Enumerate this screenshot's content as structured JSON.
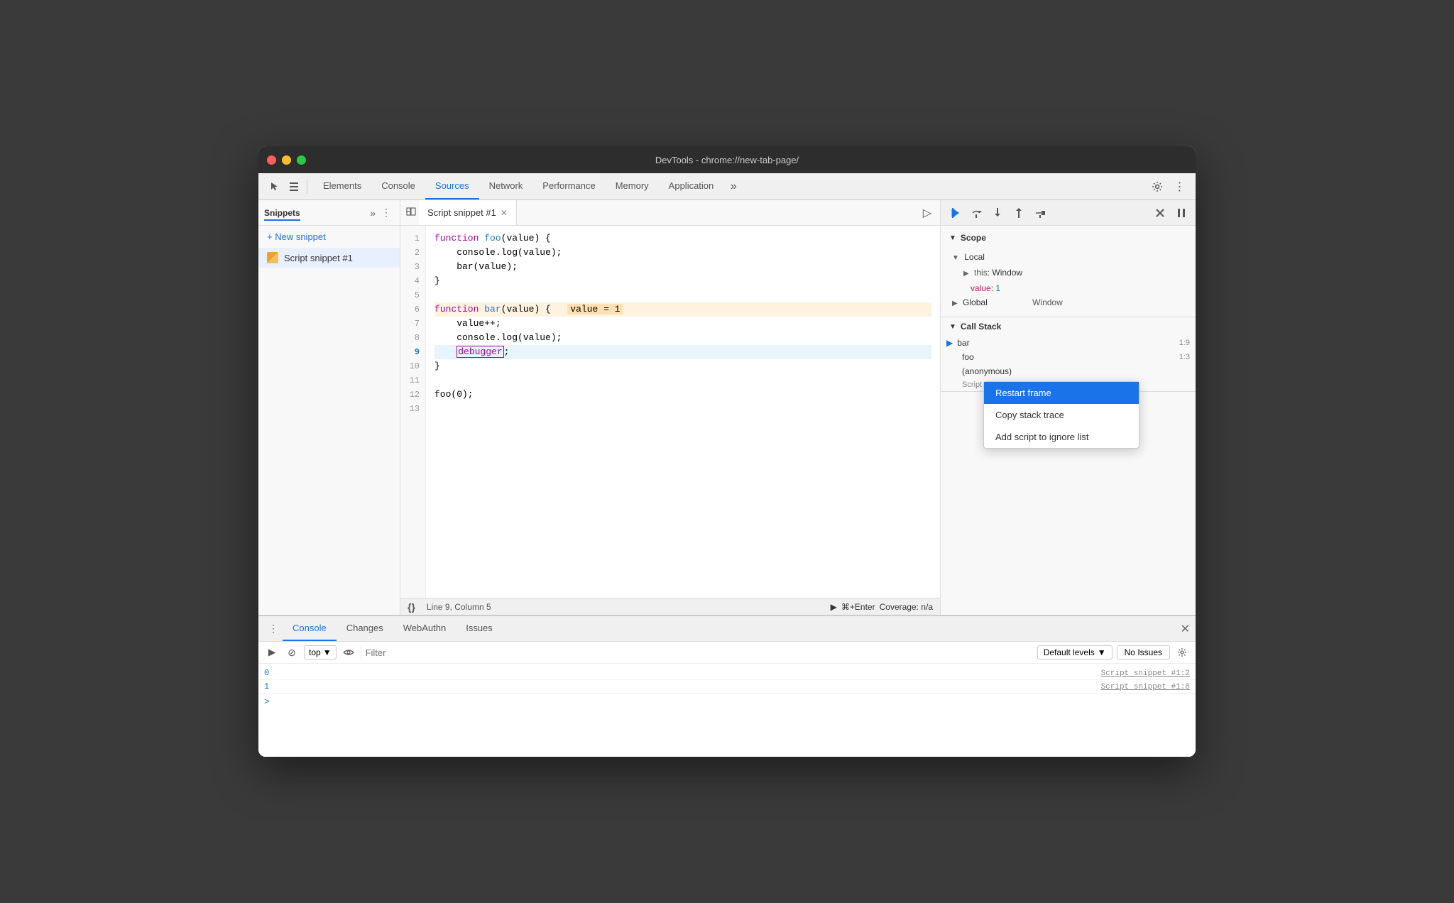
{
  "window": {
    "title": "DevTools - chrome://new-tab-page/",
    "traffic_lights": [
      "close",
      "minimize",
      "maximize"
    ]
  },
  "top_tabs": {
    "items": [
      {
        "label": "Elements",
        "active": false
      },
      {
        "label": "Console",
        "active": false
      },
      {
        "label": "Sources",
        "active": true
      },
      {
        "label": "Network",
        "active": false
      },
      {
        "label": "Performance",
        "active": false
      },
      {
        "label": "Memory",
        "active": false
      },
      {
        "label": "Application",
        "active": false
      }
    ]
  },
  "sidebar": {
    "title": "Snippets",
    "new_snippet_label": "+ New snippet",
    "snippet_name": "Script snippet #1"
  },
  "editor": {
    "tab_label": "Script snippet #1",
    "lines": [
      "function foo(value) {",
      "    console.log(value);",
      "    bar(value);",
      "}",
      "",
      "function bar(value) {   value = 1",
      "    value++;",
      "    console.log(value);",
      "    debugger;",
      "}",
      "",
      "foo(0);",
      ""
    ],
    "active_line": 9,
    "status": {
      "line_col": "Line 9, Column 5",
      "run_shortcut": "⌘+Enter",
      "coverage": "Coverage: n/a"
    }
  },
  "right_panel": {
    "scope": {
      "title": "Scope",
      "local_title": "Local",
      "this_label": "this",
      "this_value": "Window",
      "value_label": "value",
      "value_num": "1",
      "global_title": "Global",
      "global_value": "Window"
    },
    "call_stack": {
      "title": "Call Stack",
      "items": [
        {
          "name": "bar",
          "loc": "1:9",
          "active": true
        },
        {
          "name": "foo",
          "loc": "1:3"
        },
        {
          "name": "(anonymous)",
          "loc": ""
        },
        {
          "sub": "Script snippet #1:12"
        }
      ]
    },
    "context_menu": {
      "items": [
        {
          "label": "Restart frame",
          "selected": true
        },
        {
          "label": "Copy stack trace",
          "selected": false
        },
        {
          "label": "Add script to ignore list",
          "selected": false
        }
      ]
    }
  },
  "bottom_panel": {
    "tabs": [
      {
        "label": "Console",
        "active": true
      },
      {
        "label": "Changes",
        "active": false
      },
      {
        "label": "WebAuthn",
        "active": false
      },
      {
        "label": "Issues",
        "active": false
      }
    ],
    "console": {
      "filter_placeholder": "Filter",
      "top_label": "top",
      "levels_label": "Default levels",
      "no_issues_label": "No Issues",
      "rows": [
        {
          "value": "0",
          "source": "Script snippet #1:2"
        },
        {
          "value": "1",
          "source": "Script snippet #1:8"
        }
      ]
    }
  }
}
